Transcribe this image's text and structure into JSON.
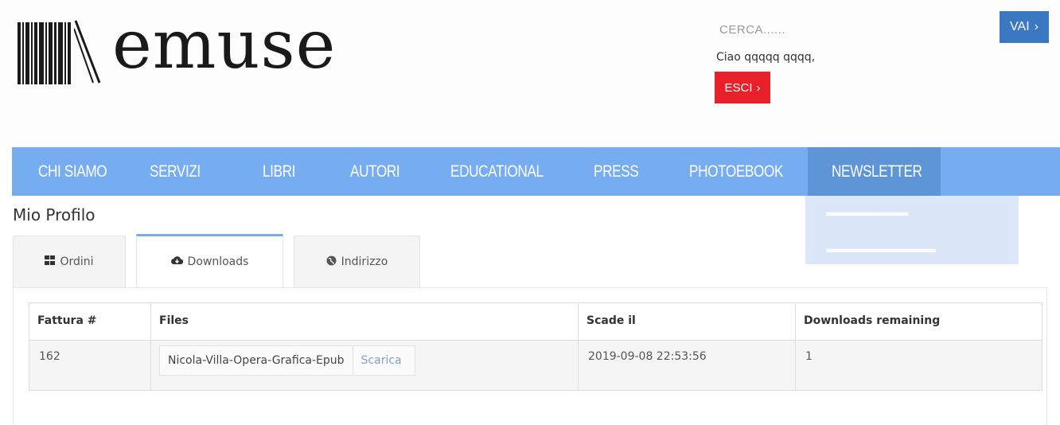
{
  "header": {
    "logo_text": "emuse",
    "search_placeholder": "CERCA......",
    "search_button": "VAI",
    "greeting": "Ciao qqqqq qqqq,",
    "logout_button": "ESCI"
  },
  "nav": {
    "items": [
      "CHI SIAMO",
      "SERVIZI",
      "LIBRI",
      "AUTORI",
      "EDUCATIONAL",
      "PRESS",
      "PHOTOEBOOK",
      "NEWSLETTER"
    ]
  },
  "profile": {
    "title": "Mio Profilo",
    "tabs": [
      {
        "label": "Ordini",
        "icon": "grid-icon"
      },
      {
        "label": "Downloads",
        "icon": "cloud-download-icon"
      },
      {
        "label": "Indirizzo",
        "icon": "globe-icon"
      }
    ],
    "active_tab": "Downloads"
  },
  "downloads_table": {
    "headers": [
      "Fattura #",
      "Files",
      "Scade il",
      "Downloads remaining"
    ],
    "rows": [
      {
        "fattura": "162",
        "file_name": "Nicola-Villa-Opera-Grafica-Epub",
        "file_action": "Scarica",
        "scade_il": "2019-09-08 22:53:56",
        "remaining": "1"
      }
    ]
  },
  "colors": {
    "nav_bg": "#76acf0",
    "nav_active": "#5e95d6",
    "search_button": "#3b78c2",
    "logout_button": "#e8202a",
    "link": "#7fa3c8"
  }
}
